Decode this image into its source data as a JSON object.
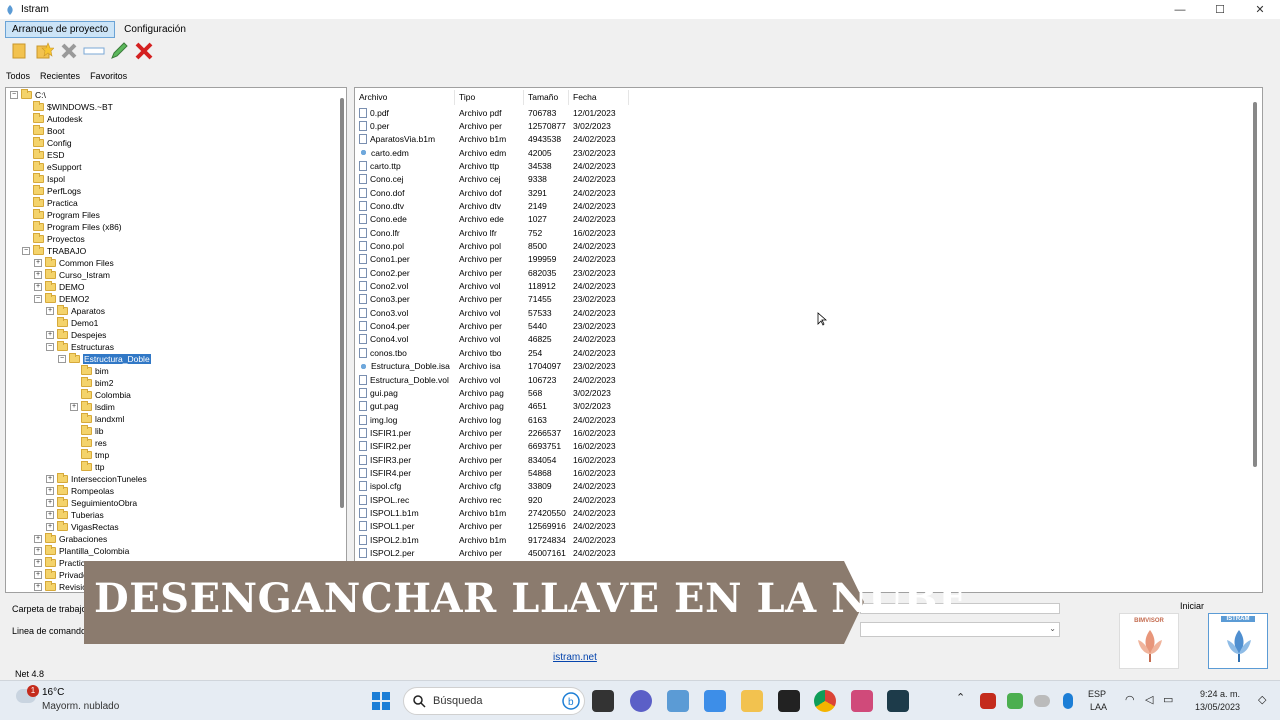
{
  "window": {
    "title": "Istram",
    "minimize": "—",
    "maximize": "☐",
    "close": "✕"
  },
  "menu": [
    {
      "label": "Arranque de proyecto"
    },
    {
      "label": "Configuración"
    }
  ],
  "tabs": [
    {
      "label": "Todos"
    },
    {
      "label": "Recientes"
    },
    {
      "label": "Favoritos"
    }
  ],
  "tree": [
    {
      "label": "C:\\",
      "depth": 0,
      "exp": "−"
    },
    {
      "label": "$WINDOWS.~BT",
      "depth": 1,
      "exp": ""
    },
    {
      "label": "Autodesk",
      "depth": 1,
      "exp": ""
    },
    {
      "label": "Boot",
      "depth": 1,
      "exp": ""
    },
    {
      "label": "Config",
      "depth": 1,
      "exp": ""
    },
    {
      "label": "ESD",
      "depth": 1,
      "exp": ""
    },
    {
      "label": "eSupport",
      "depth": 1,
      "exp": ""
    },
    {
      "label": "Ispol",
      "depth": 1,
      "exp": ""
    },
    {
      "label": "PerfLogs",
      "depth": 1,
      "exp": ""
    },
    {
      "label": "Practica",
      "depth": 1,
      "exp": ""
    },
    {
      "label": "Program Files",
      "depth": 1,
      "exp": ""
    },
    {
      "label": "Program Files (x86)",
      "depth": 1,
      "exp": ""
    },
    {
      "label": "Proyectos",
      "depth": 1,
      "exp": ""
    },
    {
      "label": "TRABAJO",
      "depth": 1,
      "exp": "−"
    },
    {
      "label": "Common Files",
      "depth": 2,
      "exp": "+"
    },
    {
      "label": "Curso_Istram",
      "depth": 2,
      "exp": "+"
    },
    {
      "label": "DEMO",
      "depth": 2,
      "exp": "+"
    },
    {
      "label": "DEMO2",
      "depth": 2,
      "exp": "−"
    },
    {
      "label": "Aparatos",
      "depth": 3,
      "exp": "+"
    },
    {
      "label": "Demo1",
      "depth": 3,
      "exp": ""
    },
    {
      "label": "Despejes",
      "depth": 3,
      "exp": "+"
    },
    {
      "label": "Estructuras",
      "depth": 3,
      "exp": "−"
    },
    {
      "label": "Estructura_Doble",
      "depth": 4,
      "exp": "−",
      "selected": true
    },
    {
      "label": "bim",
      "depth": 5,
      "exp": ""
    },
    {
      "label": "bim2",
      "depth": 5,
      "exp": ""
    },
    {
      "label": "Colombia",
      "depth": 5,
      "exp": ""
    },
    {
      "label": "lsdim",
      "depth": 5,
      "exp": "+"
    },
    {
      "label": "landxml",
      "depth": 5,
      "exp": ""
    },
    {
      "label": "lib",
      "depth": 5,
      "exp": ""
    },
    {
      "label": "res",
      "depth": 5,
      "exp": ""
    },
    {
      "label": "tmp",
      "depth": 5,
      "exp": ""
    },
    {
      "label": "ttp",
      "depth": 5,
      "exp": ""
    },
    {
      "label": "InterseccionTuneles",
      "depth": 3,
      "exp": "+"
    },
    {
      "label": "Rompeolas",
      "depth": 3,
      "exp": "+"
    },
    {
      "label": "SeguimientoObra",
      "depth": 3,
      "exp": "+"
    },
    {
      "label": "Tuberias",
      "depth": 3,
      "exp": "+"
    },
    {
      "label": "VigasRectas",
      "depth": 3,
      "exp": "+"
    },
    {
      "label": "Grabaciones",
      "depth": 2,
      "exp": "+"
    },
    {
      "label": "Plantilla_Colombia",
      "depth": 2,
      "exp": "+"
    },
    {
      "label": "Practicas...",
      "depth": 2,
      "exp": "+"
    },
    {
      "label": "Privado",
      "depth": 2,
      "exp": "+"
    },
    {
      "label": "Revisiones",
      "depth": 2,
      "exp": "+"
    }
  ],
  "files": {
    "columns": [
      "Archivo",
      "Tipo",
      "Tamaño",
      "Fecha"
    ],
    "rows": [
      [
        "0.pdf",
        "Archivo pdf",
        "706783",
        "12/01/2023"
      ],
      [
        "0.per",
        "Archivo per",
        "12570877",
        "3/02/2023"
      ],
      [
        "AparatosVia.b1m",
        "Archivo b1m",
        "4943538",
        "24/02/2023"
      ],
      [
        "carto.edm",
        "Archivo edm",
        "42005",
        "23/02/2023"
      ],
      [
        "carto.ttp",
        "Archivo ttp",
        "34538",
        "24/02/2023"
      ],
      [
        "Cono.cej",
        "Archivo cej",
        "9338",
        "24/02/2023"
      ],
      [
        "Cono.dof",
        "Archivo dof",
        "3291",
        "24/02/2023"
      ],
      [
        "Cono.dtv",
        "Archivo dtv",
        "2149",
        "24/02/2023"
      ],
      [
        "Cono.ede",
        "Archivo ede",
        "1027",
        "24/02/2023"
      ],
      [
        "Cono.lfr",
        "Archivo lfr",
        "752",
        "16/02/2023"
      ],
      [
        "Cono.pol",
        "Archivo pol",
        "8500",
        "24/02/2023"
      ],
      [
        "Cono1.per",
        "Archivo per",
        "199959",
        "24/02/2023"
      ],
      [
        "Cono2.per",
        "Archivo per",
        "682035",
        "23/02/2023"
      ],
      [
        "Cono2.vol",
        "Archivo vol",
        "118912",
        "24/02/2023"
      ],
      [
        "Cono3.per",
        "Archivo per",
        "71455",
        "23/02/2023"
      ],
      [
        "Cono3.vol",
        "Archivo vol",
        "57533",
        "24/02/2023"
      ],
      [
        "Cono4.per",
        "Archivo per",
        "5440",
        "23/02/2023"
      ],
      [
        "Cono4.vol",
        "Archivo vol",
        "46825",
        "24/02/2023"
      ],
      [
        "conos.tbo",
        "Archivo tbo",
        "254",
        "24/02/2023"
      ],
      [
        "Estructura_Doble.isa",
        "Archivo isa",
        "1704097",
        "23/02/2023"
      ],
      [
        "Estructura_Doble.vol",
        "Archivo vol",
        "106723",
        "24/02/2023"
      ],
      [
        "gui.pag",
        "Archivo pag",
        "568",
        "3/02/2023"
      ],
      [
        "gut.pag",
        "Archivo pag",
        "4651",
        "3/02/2023"
      ],
      [
        "img.log",
        "Archivo log",
        "6163",
        "24/02/2023"
      ],
      [
        "ISFIR1.per",
        "Archivo per",
        "2266537",
        "16/02/2023"
      ],
      [
        "ISFIR2.per",
        "Archivo per",
        "6693751",
        "16/02/2023"
      ],
      [
        "ISFIR3.per",
        "Archivo per",
        "834054",
        "16/02/2023"
      ],
      [
        "ISFIR4.per",
        "Archivo per",
        "54868",
        "16/02/2023"
      ],
      [
        "ispol.cfg",
        "Archivo cfg",
        "33809",
        "24/02/2023"
      ],
      [
        "ISPOL.rec",
        "Archivo rec",
        "920",
        "24/02/2023"
      ],
      [
        "ISPOL1.b1m",
        "Archivo b1m",
        "27420550",
        "24/02/2023"
      ],
      [
        "ISPOL1.per",
        "Archivo per",
        "12569916",
        "24/02/2023"
      ],
      [
        "ISPOL2.b1m",
        "Archivo b1m",
        "91724834",
        "24/02/2023"
      ],
      [
        "ISPOL2.per",
        "Archivo per",
        "45007161",
        "24/02/2023"
      ]
    ]
  },
  "banner": {
    "text": "DESENGANCHAR LLAVE EN LA NUBE"
  },
  "form": {
    "carpeta_label": "Carpeta de trabajo",
    "linea_label": "Linea de comandos"
  },
  "footer": {
    "link": "istram.net",
    "version": "Net 4.8",
    "iniciar": "Iniciar",
    "logo1": "BIMVISOR",
    "logo2": "ISTRAM"
  },
  "taskbar": {
    "temp": "16°C",
    "weather": "Mayorm. nublado",
    "badge": "1",
    "search": "Búsqueda",
    "lang1": "ESP",
    "lang2": "LAA",
    "time": "9:24 a. m.",
    "date": "13/05/2023"
  },
  "colors": {
    "selection": "#3178c6",
    "banner": "#8b7b6e"
  }
}
